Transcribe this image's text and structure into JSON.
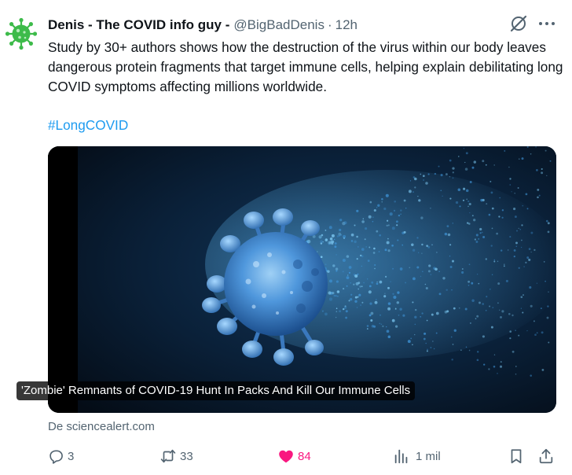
{
  "tweet": {
    "display_name": "Denis - The COVID info guy -",
    "handle": "@BigBadDenis",
    "separator": "·",
    "time": "12h",
    "avatar_icon": "virus-icon",
    "text": "Study by 30+ authors shows how the destruction of the virus within our body leaves dangerous protein fragments that target immune cells, helping explain debilitating long COVID symptoms affecting millions worldwide.",
    "hashtag": "#LongCOVID"
  },
  "card": {
    "title": "'Zombie' Remnants of COVID-19 Hunt In Packs And Kill Our Immune Cells",
    "source": "De sciencealert.com",
    "image_subject": "virus-particle-disintegrating-image"
  },
  "actions": {
    "reply_count": "3",
    "retweet_count": "33",
    "like_count": "84",
    "views_count": "1 mil"
  },
  "colors": {
    "accent": "#1d9bf0",
    "like": "#f91880",
    "secondary_text": "#536471",
    "avatar_green": "#3dbb4a"
  }
}
